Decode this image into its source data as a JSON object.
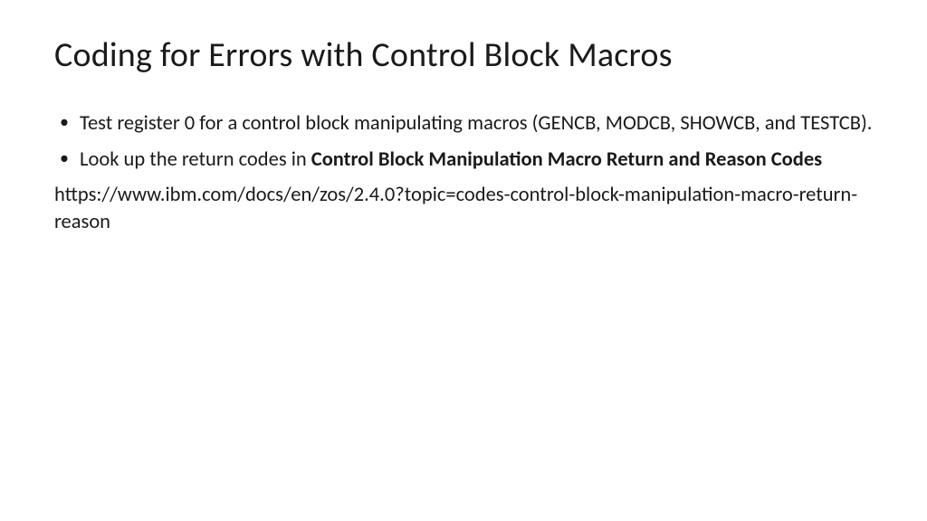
{
  "title": "Coding for Errors with Control Block Macros",
  "bullets": [
    {
      "text": "Test register 0 for a control block manipulating macros (GENCB, MODCB, SHOWCB, and TESTCB)."
    },
    {
      "prefix": "Look up the return codes in ",
      "bold": "Control Block Manipulation Macro Return and Reason Codes"
    }
  ],
  "url": "https://www.ibm.com/docs/en/zos/2.4.0?topic=codes-control-block-manipulation-macro-return-reason"
}
